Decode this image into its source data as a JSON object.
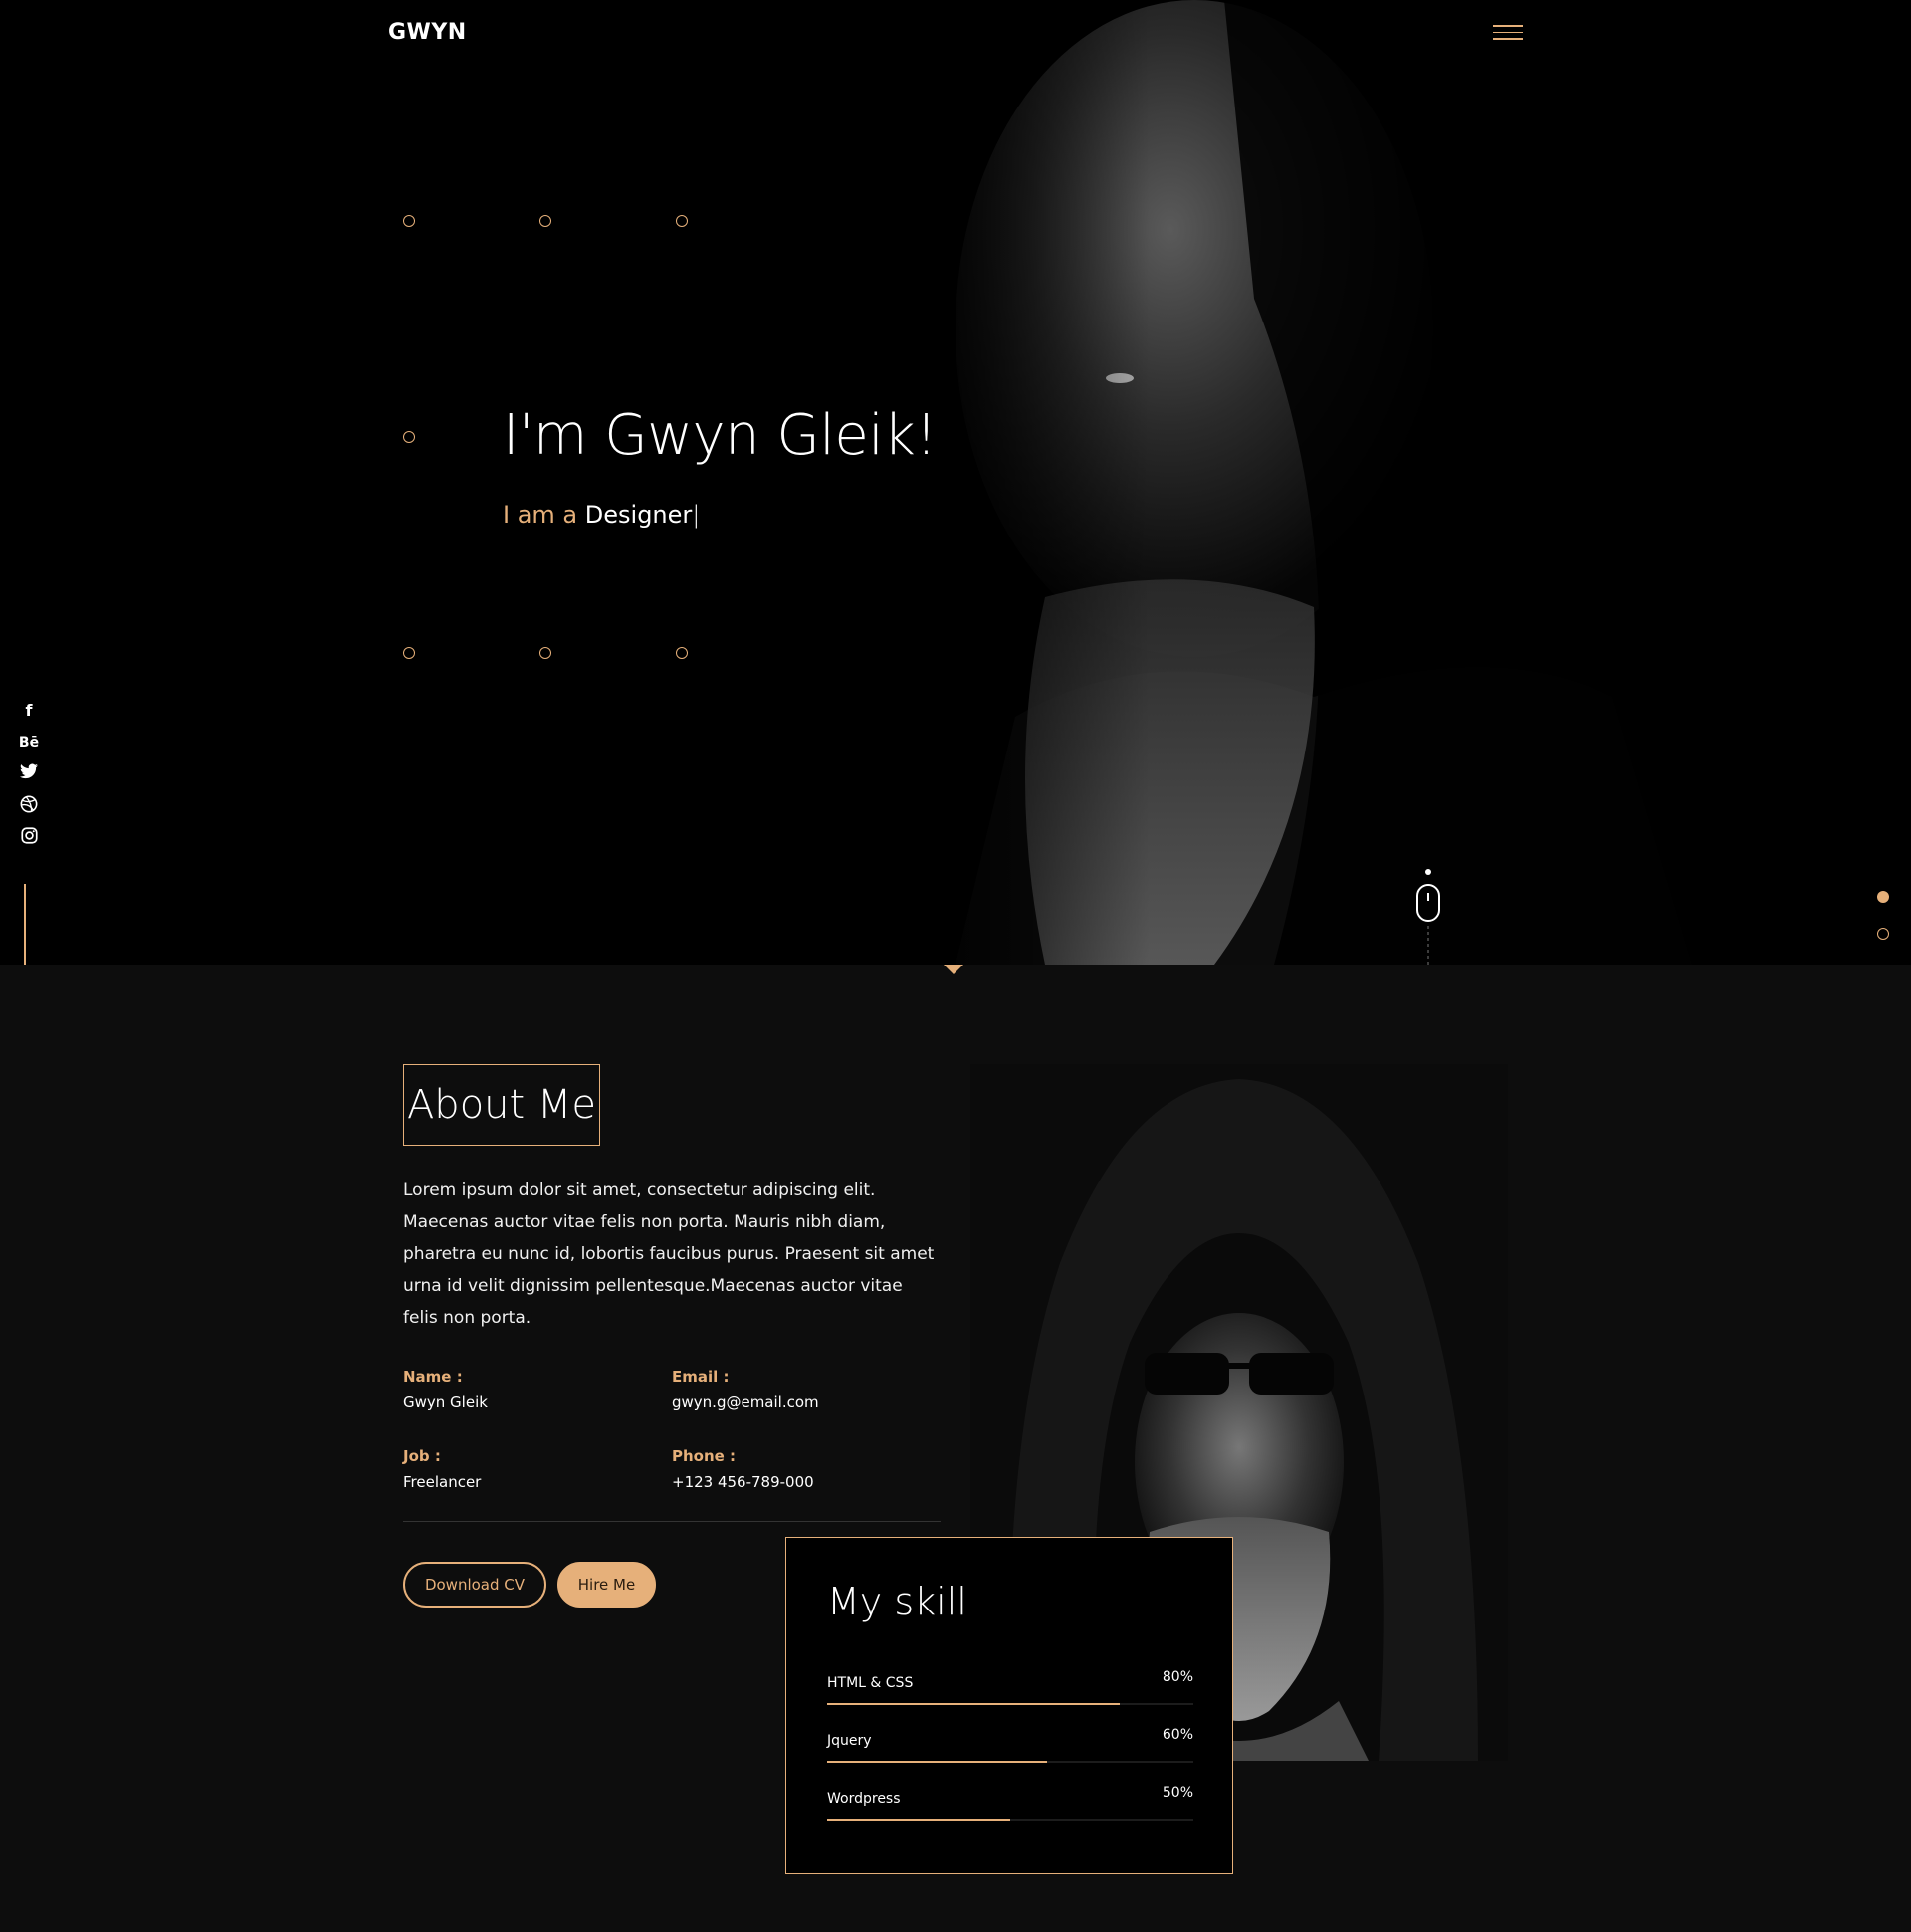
{
  "brand": {
    "logo": "GWYN"
  },
  "hero": {
    "title": "I'm Gwyn Gleik!",
    "subtitle_prefix": "I am a",
    "subtitle_role": "Designer",
    "cursor": "|"
  },
  "social": [
    {
      "name": "facebook",
      "glyph": "f"
    },
    {
      "name": "behance",
      "glyph": "Bē"
    },
    {
      "name": "twitter",
      "glyph": "🐦"
    },
    {
      "name": "dribbble",
      "glyph": "◎"
    },
    {
      "name": "instagram",
      "glyph": "◻"
    }
  ],
  "about": {
    "heading": "About Me",
    "paragraph": "Lorem ipsum dolor sit amet, consectetur adipiscing elit. Maecenas auctor vitae felis non porta. Mauris nibh diam, pharetra eu nunc id, lobortis faucibus purus. Praesent sit amet urna id velit dignissim pellentesque.Maecenas auctor vitae felis non porta.",
    "name_label": "Name :",
    "name_value": "Gwyn Gleik",
    "email_label": "Email :",
    "email_value": "gwyn.g@email.com",
    "job_label": "Job :",
    "job_value": "Freelancer",
    "phone_label": "Phone :",
    "phone_value": "+123 456-789-000",
    "download_label": "Download CV",
    "hire_label": "Hire Me"
  },
  "skills": {
    "title": "My skill",
    "items": [
      {
        "name": "HTML & CSS",
        "percent_label": "80%",
        "level": 0.8
      },
      {
        "name": "Jquery",
        "percent_label": "60%",
        "level": 0.6
      },
      {
        "name": "Wordpress",
        "percent_label": "50%",
        "level": 0.5
      }
    ]
  },
  "theme": {
    "accent": "#e6b07a",
    "background": "#0d0d0d",
    "hero_background": "#000000"
  }
}
